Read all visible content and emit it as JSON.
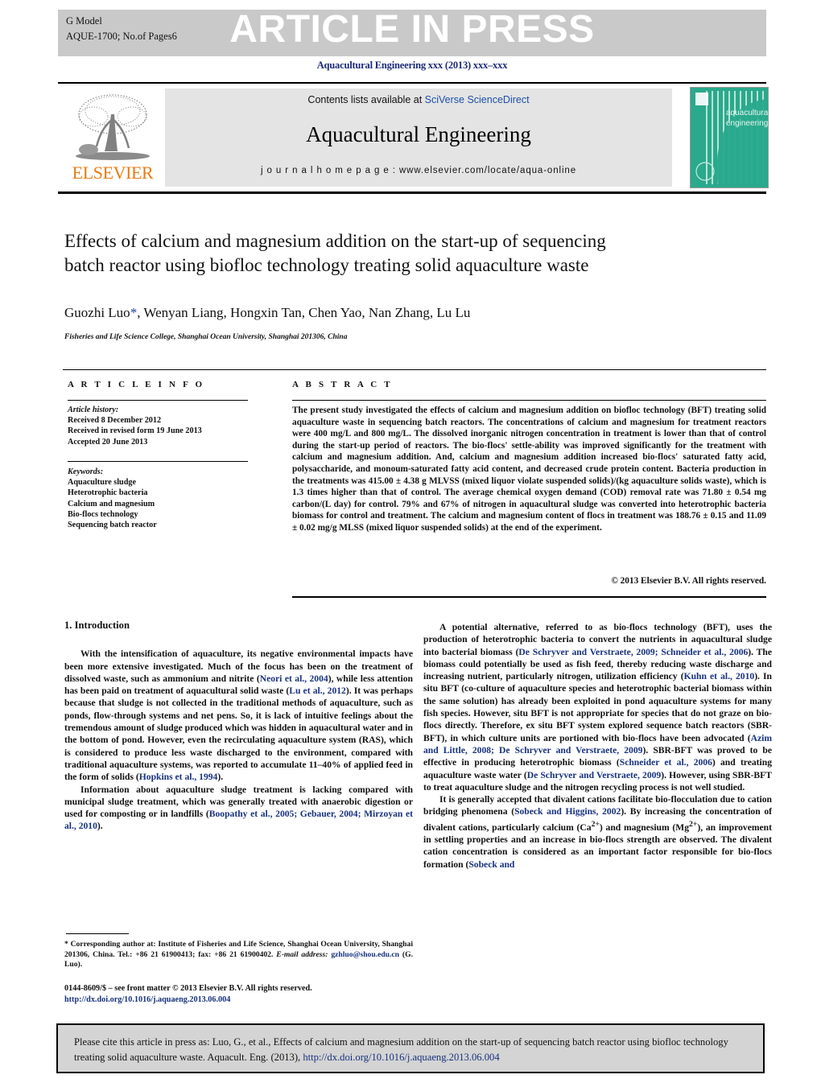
{
  "banner": {
    "g_model": "G Model",
    "article_id": "AQUE-1700;   No.of Pages6",
    "status": "ARTICLE IN PRESS"
  },
  "journal_line": "Aquacultural Engineering xxx (2013) xxx–xxx",
  "masthead": {
    "contents_prefix": "Contents lists available at ",
    "contents_link": "SciVerse ScienceDirect",
    "journal_title": "Aquacultural Engineering",
    "homepage_prefix": "j o u r n a l  h o m e p a g e :  ",
    "homepage_url": "www.elsevier.com/locate/aqua-online",
    "publisher": "ELSEVIER",
    "cover_line1": "aquacultural",
    "cover_line2": "engineering"
  },
  "article": {
    "title": "Effects of calcium and magnesium addition on the start-up of sequencing batch reactor using biofloc technology treating solid aquaculture waste",
    "authors": "Guozhi Luo",
    "authors_star": "*",
    "authors_rest": ", Wenyan Liang, Hongxin Tan, Chen Yao, Nan Zhang, Lu Lu",
    "affiliation": "Fisheries and Life Science College, Shanghai Ocean University, Shanghai 201306, China"
  },
  "info": {
    "heading": "A R T I C L E   I N F O",
    "history_label": "Article history:",
    "history": [
      "Received 8 December 2012",
      "Received in revised form 19 June 2013",
      "Accepted 20 June 2013"
    ],
    "keywords_label": "Keywords:",
    "keywords": [
      "Aquaculture sludge",
      "Heterotrophic bacteria",
      "Calcium and magnesium",
      "Bio-flocs technology",
      "Sequencing batch reactor"
    ]
  },
  "abstract": {
    "heading": "A B S T R A C T",
    "text": "The present study investigated the effects of calcium and magnesium addition on biofloc technology (BFT) treating solid aquaculture waste in sequencing batch reactors. The concentrations of calcium and magnesium for treatment reactors were 400 mg/L and 800 mg/L. The dissolved inorganic nitrogen concentration in treatment is lower than that of control during the start-up period of reactors. The bio-flocs' settle-ability was improved significantly for the treatment with calcium and magnesium addition. And, calcium and magnesium addition increased bio-flocs' saturated fatty acid, polysaccharide, and monoum-saturated fatty acid content, and decreased crude protein content. Bacteria production in the treatments was 415.00 ± 4.38 g MLVSS (mixed liquor violate suspended solids)/(kg aquaculture solids waste), which is 1.3 times higher than that of control. The average chemical oxygen demand (COD) removal rate was 71.80 ± 0.54 mg carbon/(L day) for control. 79% and 67% of nitrogen in aquacultural sludge was converted into heterotrophic bacteria biomass for control and treatment. The calcium and magnesium content of flocs in treatment was 188.76 ± 0.15 and 11.09 ± 0.02 mg/g MLSS (mixed liquor suspended solids) at the end of the experiment.",
    "copyright": "© 2013 Elsevier B.V. All rights reserved."
  },
  "body": {
    "section_heading": "1.  Introduction",
    "left_p1_a": "With the intensification of aquaculture, its negative environmental impacts have been more extensive investigated. Much of the focus has been on the treatment of dissolved waste, such as ammonium and nitrite (",
    "left_p1_ref1": "Neori et al., 2004",
    "left_p1_b": "), while less attention has been paid on treatment of aquacultural solid waste (",
    "left_p1_ref2": "Lu et al., 2012",
    "left_p1_c": "). It was perhaps because that sludge is not collected in the traditional methods of aquaculture, such as ponds, flow-through systems and net pens. So, it is lack of intuitive feelings about the tremendous amount of sludge produced which was hidden in aquacultural water and in the bottom of pond. However, even the recirculating aquaculture system (RAS), which is considered to produce less waste discharged to the environment, compared with traditional aquaculture systems, was reported to accumulate 11–40% of applied feed in the form of solids (",
    "left_p1_ref3": "Hopkins et al., 1994",
    "left_p1_d": ").",
    "left_p2_a": "Information about aquaculture sludge treatment is lacking compared with municipal sludge treatment, which was generally treated with anaerobic digestion or used for composting or in landfills (",
    "left_p2_ref1": "Boopathy et al., 2005; Gebauer, 2004; Mirzoyan et al., 2010",
    "left_p2_b": ").",
    "right_p1_a": "A potential alternative, referred to as bio-flocs technology (BFT), uses the production of heterotrophic bacteria to convert the nutrients in aquacultural sludge into bacterial biomass (",
    "right_p1_ref1": "De Schryver and Verstraete, 2009; Schneider et al., 2006",
    "right_p1_b": "). The biomass could potentially be used as fish feed, thereby reducing waste discharge and increasing nutrient, particularly nitrogen, utilization efficiency (",
    "right_p1_ref2": "Kuhn et al., 2010",
    "right_p1_c": "). In situ BFT (co-culture of aquaculture species and heterotrophic bacterial biomass within the same solution) has already been exploited in pond aquaculture systems for many fish species. However, situ BFT is not appropriate for species that do not graze on bio-flocs directly. Therefore, ex situ BFT system explored sequence batch reactors (SBR-BFT), in which culture units are portioned with bio-flocs have been advocated (",
    "right_p1_ref3": "Azim and Little, 2008; De Schryver and Verstraete, 2009",
    "right_p1_d": "). SBR-BFT was proved to be effective in producing heterotrophic biomass (",
    "right_p1_ref4": "Schneider et al., 2006",
    "right_p1_e": ") and treating aquaculture waste water (",
    "right_p1_ref5": "De Schryver and Verstraete, 2009",
    "right_p1_f": "). However, using SBR-BFT to treat aquaculture sludge and the nitrogen recycling process is not well studied.",
    "right_p2_a": "It is generally accepted that divalent cations facilitate bio-flocculation due to cation bridging phenomena (",
    "right_p2_ref1": "Sobeck and Higgins, 2002",
    "right_p2_b": "). By increasing the concentration of divalent cations, particularly calcium (Ca",
    "right_p2_sup1": "2+",
    "right_p2_c": ") and magnesium (Mg",
    "right_p2_sup2": "2+",
    "right_p2_d": "), an improvement in settling properties and an increase in bio-flocs strength are observed. The divalent cation concentration is considered as an important factor responsible for bio-flocs formation (",
    "right_p2_ref2": "Sobeck and"
  },
  "footnote": {
    "star": "*",
    "text_a": " Corresponding author at: Institute of Fisheries and Life Science, Shanghai Ocean University, Shanghai 201306, China. Tel.: +86 21 61900413; fax: +86 21 61900402.",
    "email_label": "E-mail address:",
    "email": "gzhluo@shou.edu.cn",
    "email_suffix": " (G. Luo)."
  },
  "frontmatter": {
    "line1": "0144-8609/$ – see front matter © 2013 Elsevier B.V. All rights reserved.",
    "doi": "http://dx.doi.org/10.1016/j.aquaeng.2013.06.004"
  },
  "cite_box": {
    "text": "Please cite this article in press as: Luo, G., et al., Effects of calcium and magnesium addition on the start-up of sequencing batch reactor using biofloc technology treating solid aquaculture waste. Aquacult. Eng. (2013), ",
    "link": "http://dx.doi.org/10.1016/j.aquaeng.2013.06.004"
  },
  "colors": {
    "link_blue": "#1c4fa8",
    "ref_blue": "#17317e",
    "elsevier_orange": "#e87b10",
    "banner_grey": "#c9c9c9",
    "cover_teal": "#2aa98c"
  }
}
